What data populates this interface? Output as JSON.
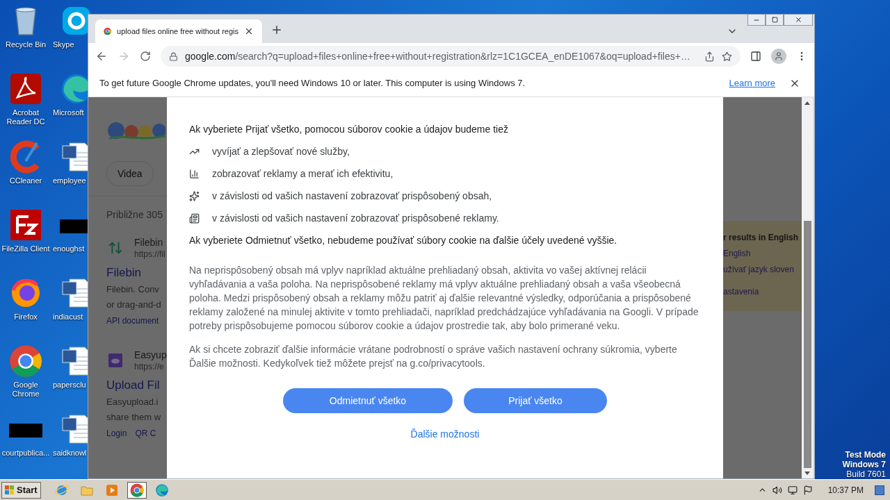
{
  "desktop": {
    "icons": [
      {
        "label": "Recycle Bin",
        "kind": "recycle"
      },
      {
        "label": "Skype",
        "kind": "skype"
      },
      {
        "label": "Acrobat Reader DC",
        "kind": "acrobat"
      },
      {
        "label": "Microsoft",
        "kind": "edge"
      },
      {
        "label": "CCleaner",
        "kind": "ccleaner"
      },
      {
        "label": "employee",
        "kind": "word"
      },
      {
        "label": "FileZilla Client",
        "kind": "filezilla"
      },
      {
        "label": "enoughst",
        "kind": "black"
      },
      {
        "label": "Firefox",
        "kind": "firefox"
      },
      {
        "label": "indiacust",
        "kind": "word"
      },
      {
        "label": "Google Chrome",
        "kind": "chrome"
      },
      {
        "label": "papersclu",
        "kind": "word"
      },
      {
        "label": "courtpublica...",
        "kind": "black"
      },
      {
        "label": "saidknowl",
        "kind": "word"
      }
    ],
    "system_info": [
      "Test Mode",
      "Windows 7",
      "Build 7601"
    ]
  },
  "browser": {
    "tab_title": "upload files online free without regis",
    "url_host": "google.com",
    "url_path": "/search?q=upload+files+online+free+without+registration&rlz=1C1GCEA_enDE1067&oq=upload+files+…",
    "infobar": {
      "text": "To get future Google Chrome updates, you'll need Windows 10 or later. This computer is using Windows 7.",
      "link": "Learn more"
    }
  },
  "background_page": {
    "chip": "Videa",
    "result_count": "Približne 305",
    "results": [
      {
        "kind": "arrows",
        "site": "Filebin",
        "url": "https://fil",
        "title": "Filebin",
        "snippet": [
          "Filebin. Conv",
          "or drag-and-d"
        ],
        "links": [
          "API document"
        ]
      },
      {
        "kind": "cloud",
        "site": "Easyup",
        "url": "https://e",
        "title": "Upload Fil",
        "snippet": [
          "Easyupload.i",
          "share them w"
        ],
        "links": [
          "Login",
          "QR C"
        ]
      }
    ],
    "side_panel": {
      "heading": "r results in English",
      "links": [
        "English",
        "užívať jazyk sloven",
        "astavenia"
      ]
    }
  },
  "consent_dialog": {
    "heading": "Ak vyberiete Prijať všetko, pomocou súborov cookie a údajov budeme tiež",
    "items": [
      {
        "kind": "trend",
        "text": "vyvíjať a zlepšovať nové služby,"
      },
      {
        "kind": "bars",
        "text": "zobrazovať reklamy a merať ich efektivitu,"
      },
      {
        "kind": "sparkle",
        "text": "v závislosti od vašich nastavení zobrazovať prispôsobený obsah,"
      },
      {
        "kind": "ad",
        "text": "v závislosti od vašich nastavení zobrazovať prispôsobené reklamy."
      }
    ],
    "decline_note": "Ak vyberiete Odmietnuť všetko, nebudeme používať súbory cookie na ďalšie účely uvedené vyššie.",
    "paragraphs": [
      "Na neprispôsobený obsah má vplyv napríklad aktuálne prehliadaný obsah, aktivita vo vašej aktívnej relácii vyhľadávania a vaša poloha. Na neprispôsobené reklamy má vplyv aktuálne prehliadaný obsah a vaša všeobecná poloha. Medzi prispôsobený obsah a reklamy môžu patriť aj ďalšie relevantné výsledky, odporúčania a prispôsobené reklamy založené na minulej aktivite v tomto prehliadači, napríklad predchádzajúce vyhľadávania na Googli. V prípade potreby prispôsobujeme pomocou súborov cookie a údajov prostredie tak, aby bolo primerané veku.",
      "Ak si chcete zobraziť ďalšie informácie vrátane podrobností o správe vašich nastavení ochrany súkromia, vyberte Ďalšie možnosti. Kedykoľvek tiež môžete prejsť na g.co/privacytools."
    ],
    "buttons": [
      "Odmietnuť všetko",
      "Prijať všetko"
    ],
    "more_link": "Ďalšie možnosti"
  },
  "taskbar": {
    "start": "Start",
    "apps": [
      {
        "kind": "ie",
        "selected": false
      },
      {
        "kind": "folder",
        "selected": false
      },
      {
        "kind": "media",
        "selected": false
      },
      {
        "kind": "chrome",
        "selected": true
      },
      {
        "kind": "edge",
        "selected": false
      }
    ],
    "clock": "10:37 PM"
  }
}
